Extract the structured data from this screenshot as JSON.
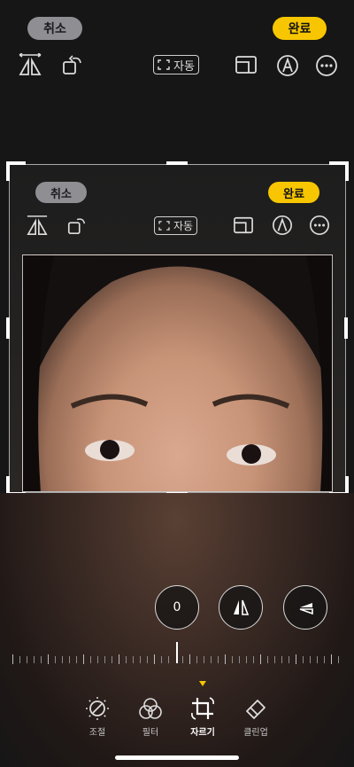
{
  "top_bar": {
    "cancel_label": "취소",
    "done_label": "완료",
    "auto_label": "자동"
  },
  "inner_bar": {
    "cancel_label": "취소",
    "done_label": "완료",
    "auto_label": "자동"
  },
  "adjust_controls": {
    "value_label": "0"
  },
  "tools": [
    {
      "label": "조절",
      "icon": "adjust-icon",
      "active": false
    },
    {
      "label": "필터",
      "icon": "filter-icon",
      "active": false
    },
    {
      "label": "자르기",
      "icon": "crop-icon",
      "active": true
    },
    {
      "label": "클린업",
      "icon": "eraser-icon",
      "active": false
    }
  ],
  "colors": {
    "accent": "#f7c600",
    "cancel_pill": "#8e8e93",
    "background": "#161616"
  }
}
